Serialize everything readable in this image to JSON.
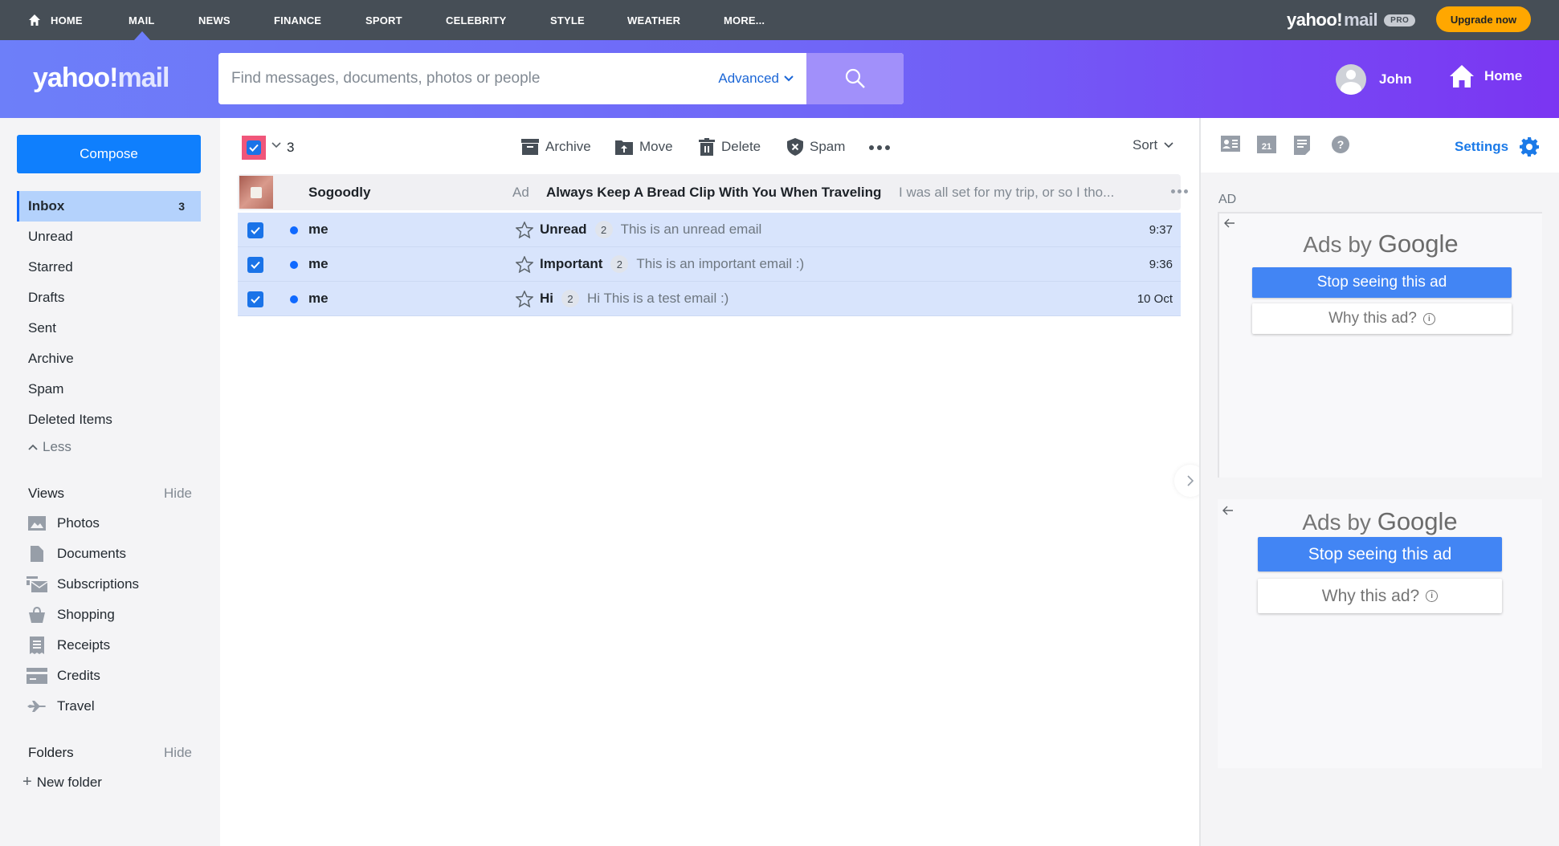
{
  "topnav": {
    "items": [
      {
        "label": "HOME",
        "icon": "home-icon"
      },
      {
        "label": "MAIL",
        "active": true
      },
      {
        "label": "NEWS"
      },
      {
        "label": "FINANCE"
      },
      {
        "label": "SPORT"
      },
      {
        "label": "CELEBRITY"
      },
      {
        "label": "STYLE"
      },
      {
        "label": "WEATHER"
      },
      {
        "label": "MORE..."
      }
    ],
    "pro_logo": {
      "yahoo": "yahoo!",
      "mail": "mail",
      "badge": "PRO"
    },
    "upgrade_label": "Upgrade now"
  },
  "header": {
    "logo": {
      "yahoo": "yahoo!",
      "mail": "mail"
    },
    "search": {
      "placeholder": "Find messages, documents, photos or people",
      "value": "",
      "advanced_label": "Advanced"
    },
    "user_name": "John",
    "home_label": "Home"
  },
  "sidebar": {
    "compose_label": "Compose",
    "folders": [
      {
        "label": "Inbox",
        "count": "3",
        "active": true
      },
      {
        "label": "Unread"
      },
      {
        "label": "Starred"
      },
      {
        "label": "Drafts"
      },
      {
        "label": "Sent"
      },
      {
        "label": "Archive"
      },
      {
        "label": "Spam"
      },
      {
        "label": "Deleted Items"
      }
    ],
    "less_label": "Less",
    "views_header": "Views",
    "views_hide": "Hide",
    "views": [
      {
        "label": "Photos",
        "icon": "photos-icon"
      },
      {
        "label": "Documents",
        "icon": "document-icon"
      },
      {
        "label": "Subscriptions",
        "icon": "subscriptions-icon"
      },
      {
        "label": "Shopping",
        "icon": "shopping-bag-icon"
      },
      {
        "label": "Receipts",
        "icon": "receipt-icon"
      },
      {
        "label": "Credits",
        "icon": "credit-card-icon"
      },
      {
        "label": "Travel",
        "icon": "airplane-icon"
      }
    ],
    "folders_header": "Folders",
    "folders_hide": "Hide",
    "new_folder_label": "New folder"
  },
  "toolbar": {
    "selected_count": "3",
    "archive_label": "Archive",
    "move_label": "Move",
    "delete_label": "Delete",
    "spam_label": "Spam",
    "sort_label": "Sort"
  },
  "ad_row": {
    "sender": "Sogoodly",
    "ad_label": "Ad",
    "subject": "Always Keep A Bread Clip With You When Traveling",
    "snippet": "I was all set for my trip, or so I tho..."
  },
  "emails": [
    {
      "sender": "me",
      "subject": "Unread",
      "count": "2",
      "snippet": "This is an unread email",
      "time": "9:37",
      "checked": true,
      "unread": true
    },
    {
      "sender": "me",
      "subject": "Important",
      "count": "2",
      "snippet": "This is an important email :)",
      "time": "9:36",
      "checked": true,
      "unread": true
    },
    {
      "sender": "me",
      "subject": "Hi",
      "count": "2",
      "snippet": "Hi This is a test email :)",
      "time": "10 Oct",
      "checked": true,
      "unread": true
    }
  ],
  "right_panel": {
    "calendar_day": "21",
    "settings_label": "Settings",
    "ad_tag": "AD",
    "ads": [
      {
        "ads_by": "Ads by",
        "google": "Google",
        "stop_label": "Stop seeing this ad",
        "why_label": "Why this ad?"
      },
      {
        "ads_by": "Ads by",
        "google": "Google",
        "stop_label": "Stop seeing this ad",
        "why_label": "Why this ad?"
      }
    ]
  },
  "colors": {
    "accent": "#0f7ffd",
    "header_gradient_start": "#6d7ff9",
    "header_gradient_end": "#7b35f2",
    "topnav_bg": "#464e56",
    "upgrade_bg": "#ffa700",
    "selected_row_bg": "#d8e4fc",
    "google_blue": "#4285f4"
  }
}
